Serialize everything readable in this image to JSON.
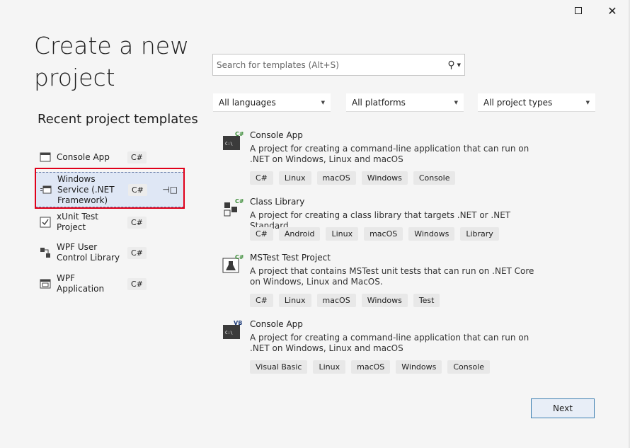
{
  "window": {
    "maximize_icon": "maximize-icon",
    "close_icon": "close-icon",
    "close_glyph": "✕"
  },
  "title": "Create a new project",
  "recent": {
    "heading": "Recent project templates",
    "items": [
      {
        "label": "Console App",
        "lang": "C#",
        "icon": "console-app-icon"
      },
      {
        "label": "Windows Service (.NET Framework)",
        "lang": "C#",
        "icon": "windows-service-icon",
        "selected": true
      },
      {
        "label": "xUnit Test Project",
        "lang": "C#",
        "icon": "xunit-test-icon"
      },
      {
        "label": "WPF User Control Library",
        "lang": "C#",
        "icon": "wpf-control-library-icon"
      },
      {
        "label": "WPF Application",
        "lang": "C#",
        "icon": "wpf-application-icon"
      }
    ]
  },
  "search": {
    "placeholder": "Search for templates (Alt+S)"
  },
  "filters": {
    "language": "All languages",
    "platform": "All platforms",
    "project_type": "All project types"
  },
  "templates": [
    {
      "name": "Console App",
      "badge": "C#",
      "desc": "A project for creating a command-line application that can run on .NET on Windows, Linux and macOS",
      "tags": [
        "C#",
        "Linux",
        "macOS",
        "Windows",
        "Console"
      ]
    },
    {
      "name": "Class Library",
      "badge": "C#",
      "desc": "A project for creating a class library that targets .NET or .NET Standard",
      "tags": [
        "C#",
        "Android",
        "Linux",
        "macOS",
        "Windows",
        "Library"
      ]
    },
    {
      "name": "MSTest Test Project",
      "badge": "C#",
      "desc": "A project that contains MSTest unit tests that can run on .NET Core on Windows, Linux and MacOS.",
      "tags": [
        "C#",
        "Linux",
        "macOS",
        "Windows",
        "Test"
      ]
    },
    {
      "name": "Console App",
      "badge": "VB",
      "desc": "A project for creating a command-line application that can run on .NET on Windows, Linux and macOS",
      "tags": [
        "Visual Basic",
        "Linux",
        "macOS",
        "Windows",
        "Console"
      ]
    }
  ],
  "next_button": "Next",
  "colors": {
    "accent_border": "#3c7fb1",
    "highlight": "#e0001a",
    "csharp_badge": "#388a34",
    "vb_badge": "#1f3d7a"
  }
}
